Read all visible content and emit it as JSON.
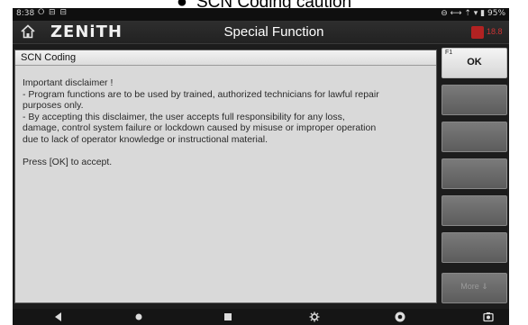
{
  "caption": {
    "bullet": "●",
    "text": "SCN Coding caution"
  },
  "status_bar": {
    "time": "8:38",
    "icons": "⭘ ⊟ ⊟",
    "right": "⊖ ⟷ ⇡ ▾ ▮ 95%"
  },
  "header": {
    "logo": "ZENiTH",
    "title": "Special Function",
    "right_label": "18.8"
  },
  "dialog": {
    "title": "SCN Coding",
    "lines": [
      "Important disclaimer !",
      "- Program functions are to be used by trained, authorized technicians for lawful repair",
      "purposes only.",
      "- By accepting this disclaimer, the user accepts full responsibility for any loss,",
      "damage, control system failure or lockdown caused by misuse or improper operation",
      "due to lack of operator knowledge or instructional material.",
      "Press [OK] to accept."
    ]
  },
  "function_keys": [
    {
      "num": "F1",
      "label": "OK"
    },
    {
      "num": "",
      "label": ""
    },
    {
      "num": "",
      "label": ""
    },
    {
      "num": "",
      "label": ""
    },
    {
      "num": "",
      "label": ""
    },
    {
      "num": "",
      "label": ""
    },
    {
      "num": "",
      "label": ""
    },
    {
      "num": "",
      "label": "More ⇓"
    }
  ],
  "colors": {
    "accent_red": "#b22222",
    "dialog_bg": "#d9d9d9",
    "header_bg": "#222222"
  },
  "icons": [
    "home-icon",
    "back-icon",
    "nav-home-icon",
    "recents-icon",
    "settings-icon",
    "chrome-icon",
    "screenshot-icon"
  ]
}
